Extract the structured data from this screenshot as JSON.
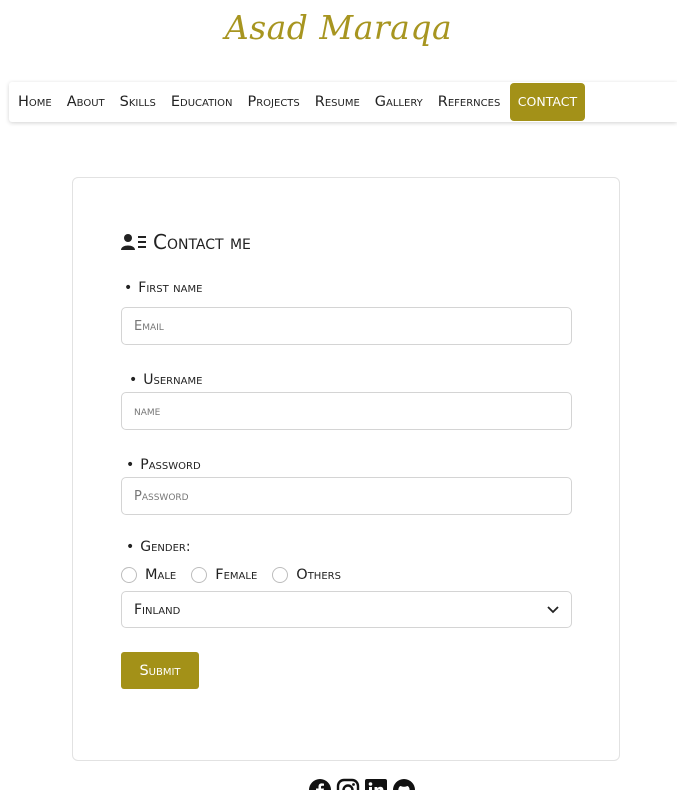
{
  "brand": {
    "name": "Asad Maraqa"
  },
  "nav": {
    "items": [
      {
        "label": "Home"
      },
      {
        "label": "About"
      },
      {
        "label": "Skills"
      },
      {
        "label": "Education"
      },
      {
        "label": "Projects"
      },
      {
        "label": "Resume"
      },
      {
        "label": "Gallery"
      },
      {
        "label": "Refernces"
      },
      {
        "label": "contact"
      }
    ],
    "active": "contact"
  },
  "form": {
    "title": "Contact me",
    "first_name": {
      "label": "First name",
      "placeholder": "Email"
    },
    "username": {
      "label": "Username",
      "placeholder": "name"
    },
    "password": {
      "label": "Password",
      "placeholder": "Password"
    },
    "gender": {
      "label": "Gender:",
      "options": [
        "Male",
        "Female",
        "Others"
      ]
    },
    "country": {
      "selected": "Finland"
    },
    "submit_label": "Submit"
  },
  "footer": {
    "socials": [
      "facebook-icon",
      "instagram-icon",
      "linkedin-icon",
      "github-icon"
    ]
  },
  "colors": {
    "accent": "#a39118",
    "brand": "#a79520"
  }
}
